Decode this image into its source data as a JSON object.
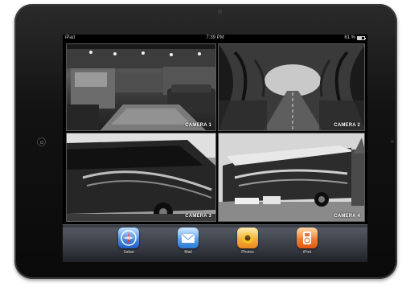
{
  "status_bar": {
    "carrier": "iPad",
    "time": "7:39 PM",
    "battery_percent": "61 %",
    "battery_level": 0.61
  },
  "cameras": [
    {
      "label": "CAMERA 1"
    },
    {
      "label": "CAMERA 2"
    },
    {
      "label": "CAMERA 3"
    },
    {
      "label": "CAMERA 4"
    }
  ],
  "dock": {
    "apps": [
      {
        "name": "Safari",
        "icon": "safari-compass-icon",
        "color": "#2f7de0"
      },
      {
        "name": "Mail",
        "icon": "mail-envelope-icon",
        "color": "#3d8fe0"
      },
      {
        "name": "Photos",
        "icon": "photos-sunflower-icon",
        "color": "#f0a623"
      },
      {
        "name": "iPod",
        "icon": "ipod-icon",
        "color": "#f07a1e"
      }
    ]
  }
}
